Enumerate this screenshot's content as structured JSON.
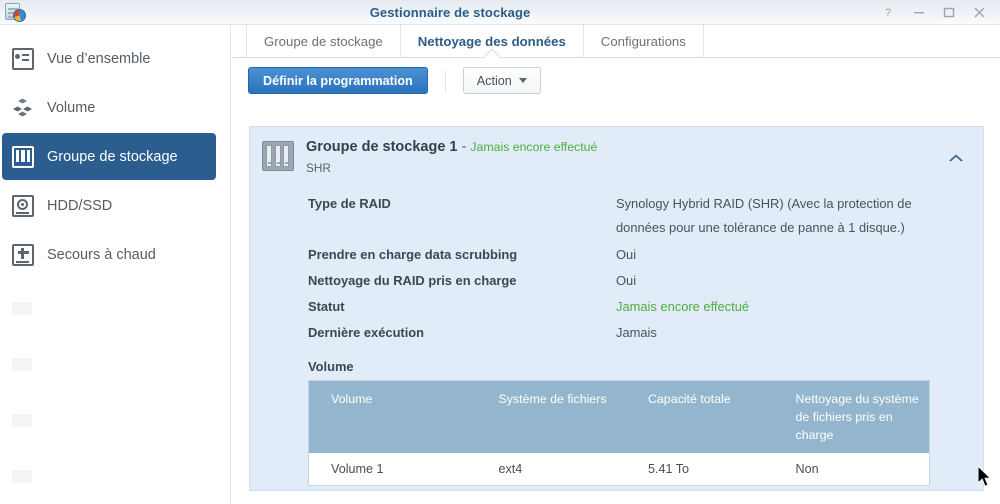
{
  "window": {
    "title": "Gestionnaire de stockage",
    "app_icon": "storage-manager-icon",
    "controls": [
      {
        "name": "help-button",
        "label": "?"
      },
      {
        "name": "minimize-button",
        "label": "–"
      },
      {
        "name": "maximize-button",
        "label": "□"
      },
      {
        "name": "close-button",
        "label": "×"
      }
    ]
  },
  "sidebar": {
    "items": [
      {
        "label": "Vue d’ensemble",
        "icon": "overview-icon",
        "active": false
      },
      {
        "label": "Volume",
        "icon": "volume-icon",
        "active": false
      },
      {
        "label": "Groupe de stockage",
        "icon": "storage-group-icon",
        "active": true
      },
      {
        "label": "HDD/SSD",
        "icon": "hdd-ssd-icon",
        "active": false
      },
      {
        "label": "Secours à chaud",
        "icon": "hot-spare-icon",
        "active": false
      }
    ]
  },
  "tabs": [
    {
      "label": "Groupe de stockage",
      "active": false
    },
    {
      "label": "Nettoyage des données",
      "active": true
    },
    {
      "label": "Configurations",
      "active": false
    }
  ],
  "toolbar": {
    "schedule_button": "Définir la programmation",
    "action_button": "Action"
  },
  "group_panel": {
    "title": "Groupe de stockage 1",
    "title_separator": " - ",
    "status_badge": "Jamais encore effectué",
    "subtitle": "SHR",
    "collapse_icon": "chevron-up-icon",
    "group_icon": "disk-array-icon",
    "details": [
      {
        "key": "Type de RAID",
        "value": "Synology Hybrid RAID (SHR) (Avec la protection de données pour une tolérance de panne à 1 disque.)",
        "green": false
      },
      {
        "key": "Prendre en charge data scrubbing",
        "value": "Oui",
        "green": false
      },
      {
        "key": "Nettoyage du RAID pris en charge",
        "value": "Oui",
        "green": false
      },
      {
        "key": "Statut",
        "value": "Jamais encore effectué",
        "green": true
      },
      {
        "key": "Dernière exécution",
        "value": "Jamais",
        "green": false
      }
    ],
    "volume_section_label": "Volume",
    "volume_table": {
      "headers": [
        "Volume",
        "Système de fichiers",
        "Capacité totale",
        "Nettoyage du système de fichiers pris en charge"
      ],
      "rows": [
        [
          "Volume 1",
          "ext4",
          "5.41 To",
          "Non"
        ]
      ]
    }
  },
  "colors": {
    "accent_blue": "#2c5d8f",
    "primary_button": "#2a72bd",
    "panel_bg": "#e1ecf8",
    "table_header": "#93b5cd",
    "status_green": "#4fae3f"
  }
}
